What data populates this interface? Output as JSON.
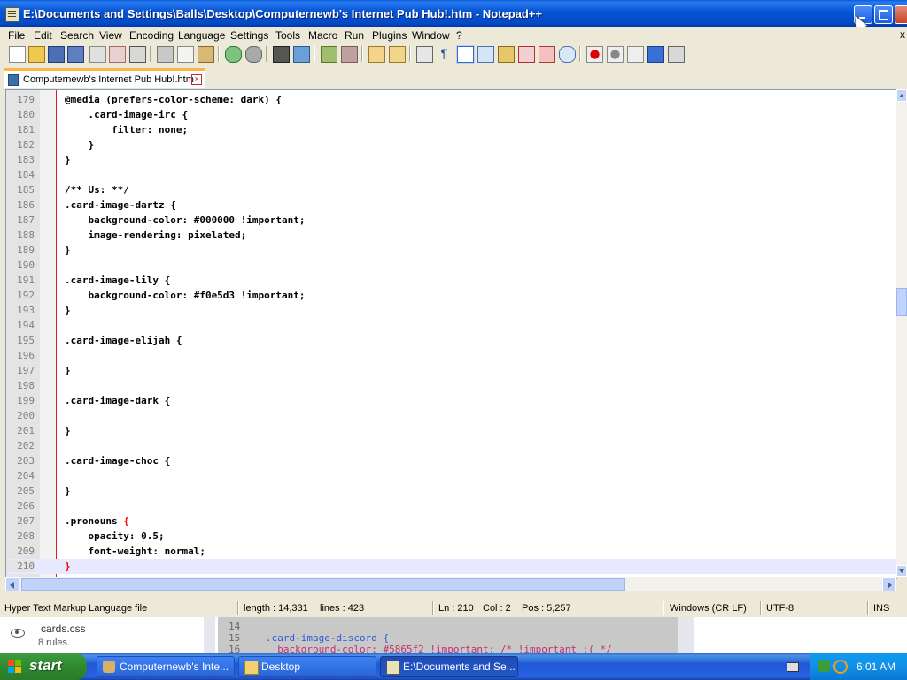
{
  "window": {
    "title": "E:\\Documents and Settings\\Balls\\Desktop\\Computernewb's Internet Pub Hub!.htm - Notepad++"
  },
  "menu": {
    "items": [
      "File",
      "Edit",
      "Search",
      "View",
      "Encoding",
      "Language",
      "Settings",
      "Tools",
      "Macro",
      "Run",
      "Plugins",
      "Window",
      "?"
    ],
    "close": "x"
  },
  "tab": {
    "label": "Computernewb's Internet Pub Hub!.htm"
  },
  "editor": {
    "lines": [
      {
        "num": "179",
        "text": "@media (prefers-color-scheme: dark) {"
      },
      {
        "num": "180",
        "text": "    .card-image-irc {"
      },
      {
        "num": "181",
        "text": "        filter: none;"
      },
      {
        "num": "182",
        "text": "    }"
      },
      {
        "num": "183",
        "text": "}"
      },
      {
        "num": "184",
        "text": ""
      },
      {
        "num": "185",
        "text": "/** Us: **/"
      },
      {
        "num": "186",
        "text": ".card-image-dartz {"
      },
      {
        "num": "187",
        "text": "    background-color: #000000 !important;"
      },
      {
        "num": "188",
        "text": "    image-rendering: pixelated;"
      },
      {
        "num": "189",
        "text": "}"
      },
      {
        "num": "190",
        "text": ""
      },
      {
        "num": "191",
        "text": ".card-image-lily {"
      },
      {
        "num": "192",
        "text": "    background-color: #f0e5d3 !important;"
      },
      {
        "num": "193",
        "text": "}"
      },
      {
        "num": "194",
        "text": ""
      },
      {
        "num": "195",
        "text": ".card-image-elijah {"
      },
      {
        "num": "196",
        "text": ""
      },
      {
        "num": "197",
        "text": "}"
      },
      {
        "num": "198",
        "text": ""
      },
      {
        "num": "199",
        "text": ".card-image-dark {"
      },
      {
        "num": "200",
        "text": ""
      },
      {
        "num": "201",
        "text": "}"
      },
      {
        "num": "202",
        "text": ""
      },
      {
        "num": "203",
        "text": ".card-image-choc {"
      },
      {
        "num": "204",
        "text": ""
      },
      {
        "num": "205",
        "text": "}"
      },
      {
        "num": "206",
        "text": ""
      },
      {
        "num": "207",
        "text": ".pronouns {"
      },
      {
        "num": "208",
        "text": "    opacity: 0.5;"
      },
      {
        "num": "209",
        "text": "    font-weight: normal;"
      },
      {
        "num": "210",
        "text": "}"
      }
    ],
    "current_line": "210"
  },
  "status": {
    "file_type": "Hyper Text Markup Language file",
    "length": "length : 14,331",
    "lines": "lines : 423",
    "ln": "Ln : 210",
    "col": "Col : 2",
    "pos": "Pos : 5,257",
    "eol": "Windows (CR LF)",
    "encoding": "UTF-8",
    "mode": "INS"
  },
  "background_window": {
    "file_name": "cards.css",
    "rules": "8 rules.",
    "code_lines": [
      {
        "num": "14",
        "text": ""
      },
      {
        "num": "15",
        "text": ".card-image-discord {"
      },
      {
        "num": "16",
        "text": "  background-color: #5865f2 !important; /* !important :( */"
      }
    ]
  },
  "taskbar": {
    "start_label": "start",
    "tasks": [
      {
        "label": "Computernewb's Inte..."
      },
      {
        "label": "Desktop"
      },
      {
        "label": "E:\\Documents and Se..."
      }
    ],
    "clock": "6:01 AM"
  },
  "colors": {
    "titlebar": "#0348c2",
    "fold_margin_line": "#d42020",
    "brace_highlight": "#ff0000",
    "current_line_bg": "#e8e8ff",
    "start_green": "#2f8a2f"
  }
}
